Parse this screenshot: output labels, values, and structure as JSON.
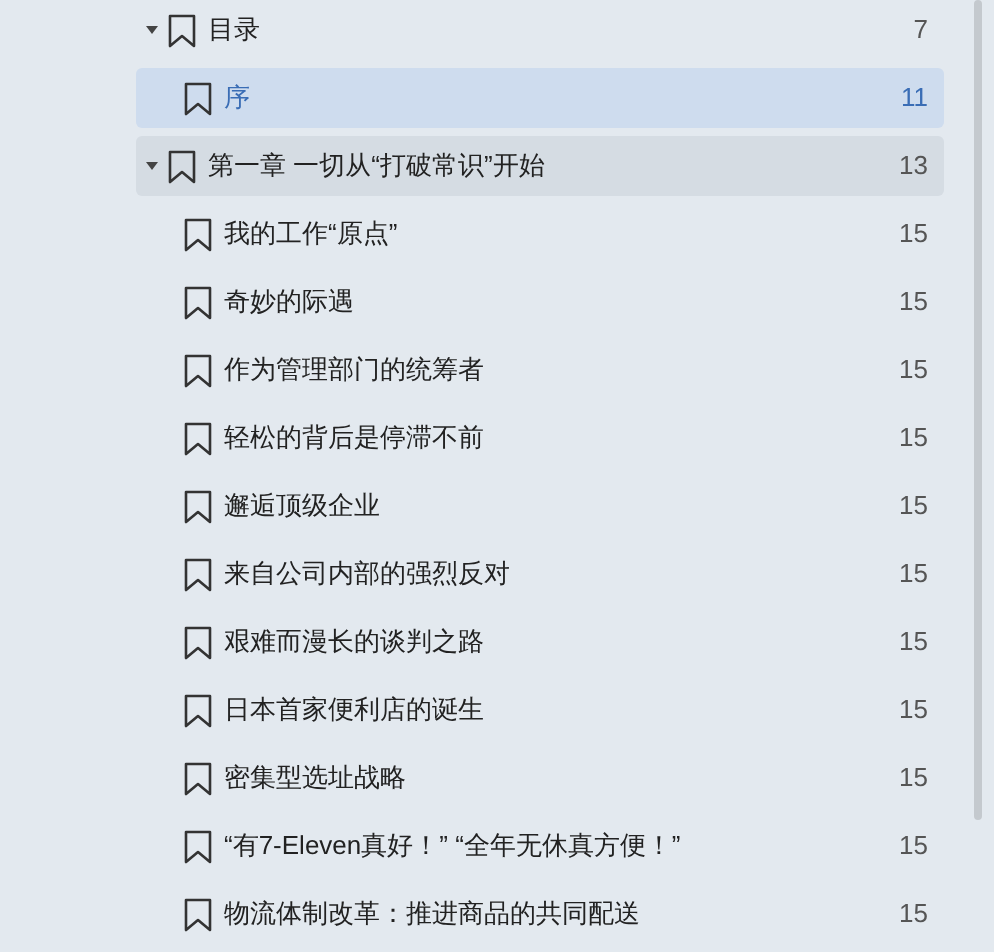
{
  "outline": [
    {
      "title": "目录",
      "page": "7",
      "expanded": true,
      "selected": false,
      "hovered": false,
      "children": [
        {
          "title": "序",
          "page": "11",
          "selected": true,
          "hovered": false
        }
      ]
    },
    {
      "title": "第一章 一切从“打破常识”开始",
      "page": "13",
      "expanded": true,
      "selected": false,
      "hovered": true,
      "children": [
        {
          "title": "我的工作“原点”",
          "page": "15",
          "selected": false,
          "hovered": false
        },
        {
          "title": "奇妙的际遇",
          "page": "15",
          "selected": false,
          "hovered": false
        },
        {
          "title": "作为管理部门的统筹者",
          "page": "15",
          "selected": false,
          "hovered": false
        },
        {
          "title": "轻松的背后是停滞不前",
          "page": "15",
          "selected": false,
          "hovered": false
        },
        {
          "title": "邂逅顶级企业",
          "page": "15",
          "selected": false,
          "hovered": false
        },
        {
          "title": "来自公司内部的强烈反对",
          "page": "15",
          "selected": false,
          "hovered": false
        },
        {
          "title": "艰难而漫长的谈判之路",
          "page": "15",
          "selected": false,
          "hovered": false
        },
        {
          "title": "日本首家便利店的诞生",
          "page": "15",
          "selected": false,
          "hovered": false
        },
        {
          "title": "密集型选址战略",
          "page": "15",
          "selected": false,
          "hovered": false
        },
        {
          "title": "“有7-Eleven真好！” “全年无休真方便！”",
          "page": "15",
          "selected": false,
          "hovered": false
        },
        {
          "title": "物流体制改革：推进商品的共同配送",
          "page": "15",
          "selected": false,
          "hovered": false
        }
      ]
    }
  ]
}
